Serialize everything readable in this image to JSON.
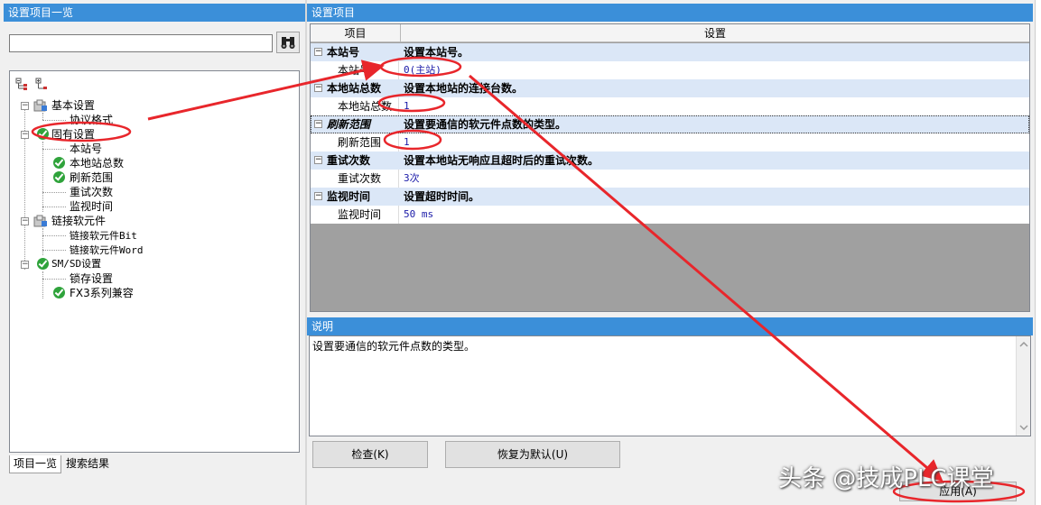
{
  "left_panel": {
    "title": "设置项目一览",
    "search": {
      "value": "",
      "placeholder": ""
    },
    "tree": [
      {
        "label": "基本设置"
      },
      {
        "label": "协议格式"
      },
      {
        "label": "固有设置"
      },
      {
        "label": "本站号"
      },
      {
        "label": "本地站总数"
      },
      {
        "label": "刷新范围"
      },
      {
        "label": "重试次数"
      },
      {
        "label": "监视时间"
      },
      {
        "label": "链接软元件"
      },
      {
        "label": "链接软元件Bit"
      },
      {
        "label": "链接软元件Word"
      },
      {
        "label": "SM/SD设置"
      },
      {
        "label": "锁存设置"
      },
      {
        "label": "FX3系列兼容"
      }
    ],
    "tabs": [
      "项目一览",
      "搜索结果"
    ]
  },
  "settings_panel": {
    "title": "设置项目",
    "columns": [
      "项目",
      "设置"
    ],
    "groups": [
      {
        "category": "本站号",
        "category_desc": "设置本站号。",
        "item": "本站号",
        "value": "0(主站)"
      },
      {
        "category": "本地站总数",
        "category_desc": "设置本地站的连接台数。",
        "item": "本地站总数",
        "value": "1"
      },
      {
        "category": "刷新范围",
        "category_desc": "设置要通信的软元件点数的类型。",
        "item": "刷新范围",
        "value": "1"
      },
      {
        "category": "重试次数",
        "category_desc": "设置本地站无响应且超时后的重试次数。",
        "item": "重试次数",
        "value": "3次"
      },
      {
        "category": "监视时间",
        "category_desc": "设置超时时间。",
        "item": "监视时间",
        "value": "50 ms"
      }
    ]
  },
  "description_panel": {
    "title": "说明",
    "text": "设置要通信的软元件点数的类型。"
  },
  "buttons": {
    "check": "检查(K)",
    "reset": "恢复为默认(U)",
    "apply": "应用(A)"
  },
  "watermark": "头条 @技成PLC课堂",
  "colors": {
    "title_bar": "#3b8fd9",
    "category_row": "#dbe7f7",
    "annotation": "#e8262b",
    "check_icon": "#2fa33b"
  }
}
